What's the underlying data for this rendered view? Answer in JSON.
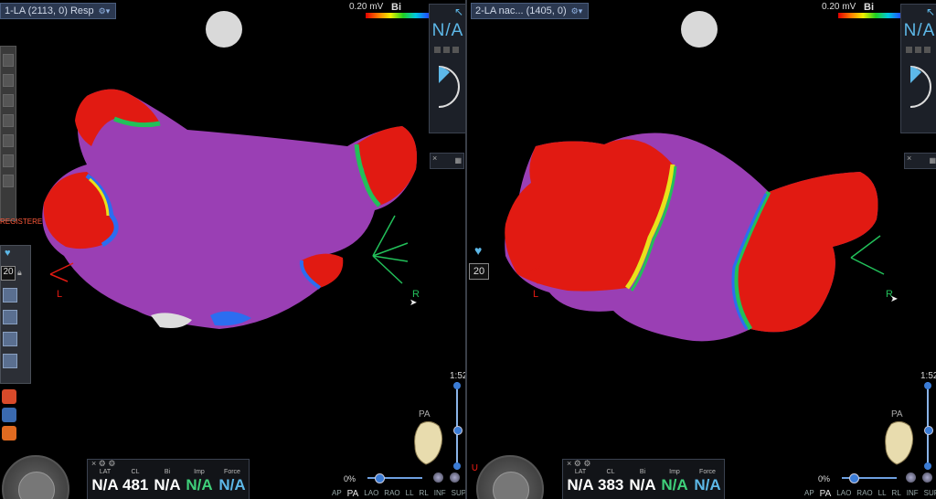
{
  "left": {
    "title": "1-LA (2113, 0) Resp",
    "scale_label": "0.20 mV",
    "scale_mode": "Bi",
    "na_text": "N/A",
    "registered_text": "REGISTERED",
    "side_number": "20",
    "orient_left": "L",
    "orient_right": "R",
    "zoom": "1:52",
    "view_top": "PA",
    "percent": "0%",
    "info": [
      {
        "label": "LAT",
        "value": "N/A",
        "color": "#ffffff"
      },
      {
        "label": "CL",
        "value": "481",
        "color": "#ffffff"
      },
      {
        "label": "Bi",
        "value": "N/A",
        "color": "#ffffff"
      },
      {
        "label": "Imp",
        "value": "N/A",
        "color": "#3fd07a"
      },
      {
        "label": "Force",
        "value": "N/A",
        "color": "#5db8e8"
      }
    ],
    "views": [
      "AP",
      "PA",
      "LAO",
      "RAO",
      "LL",
      "RL",
      "INF",
      "SUP"
    ],
    "active_view": "PA"
  },
  "right": {
    "title": "2-LA nac... (1405, 0)",
    "scale_label": "0.20 mV",
    "scale_mode": "Bi",
    "na_text": "N/A",
    "side_number": "20",
    "orient_left": "L",
    "orient_right": "R",
    "zoom": "1:52",
    "view_top": "PA",
    "percent": "0%",
    "info": [
      {
        "label": "LAT",
        "value": "N/A",
        "color": "#ffffff"
      },
      {
        "label": "CL",
        "value": "383",
        "color": "#ffffff"
      },
      {
        "label": "Bi",
        "value": "N/A",
        "color": "#ffffff"
      },
      {
        "label": "Imp",
        "value": "N/A",
        "color": "#3fd07a"
      },
      {
        "label": "Force",
        "value": "N/A",
        "color": "#5db8e8"
      }
    ],
    "views": [
      "AP",
      "PA",
      "LAO",
      "RAO",
      "LL",
      "RL",
      "INF",
      "SUP"
    ],
    "active_view": "PA"
  },
  "colors": {
    "scar_red": "#e11a12",
    "healthy_purple": "#9a3fb4",
    "border_zone_yellow": "#e8e21a",
    "border_zone_green": "#22c05a",
    "border_zone_blue": "#2c6df0",
    "accent_blue": "#5db8e8"
  }
}
